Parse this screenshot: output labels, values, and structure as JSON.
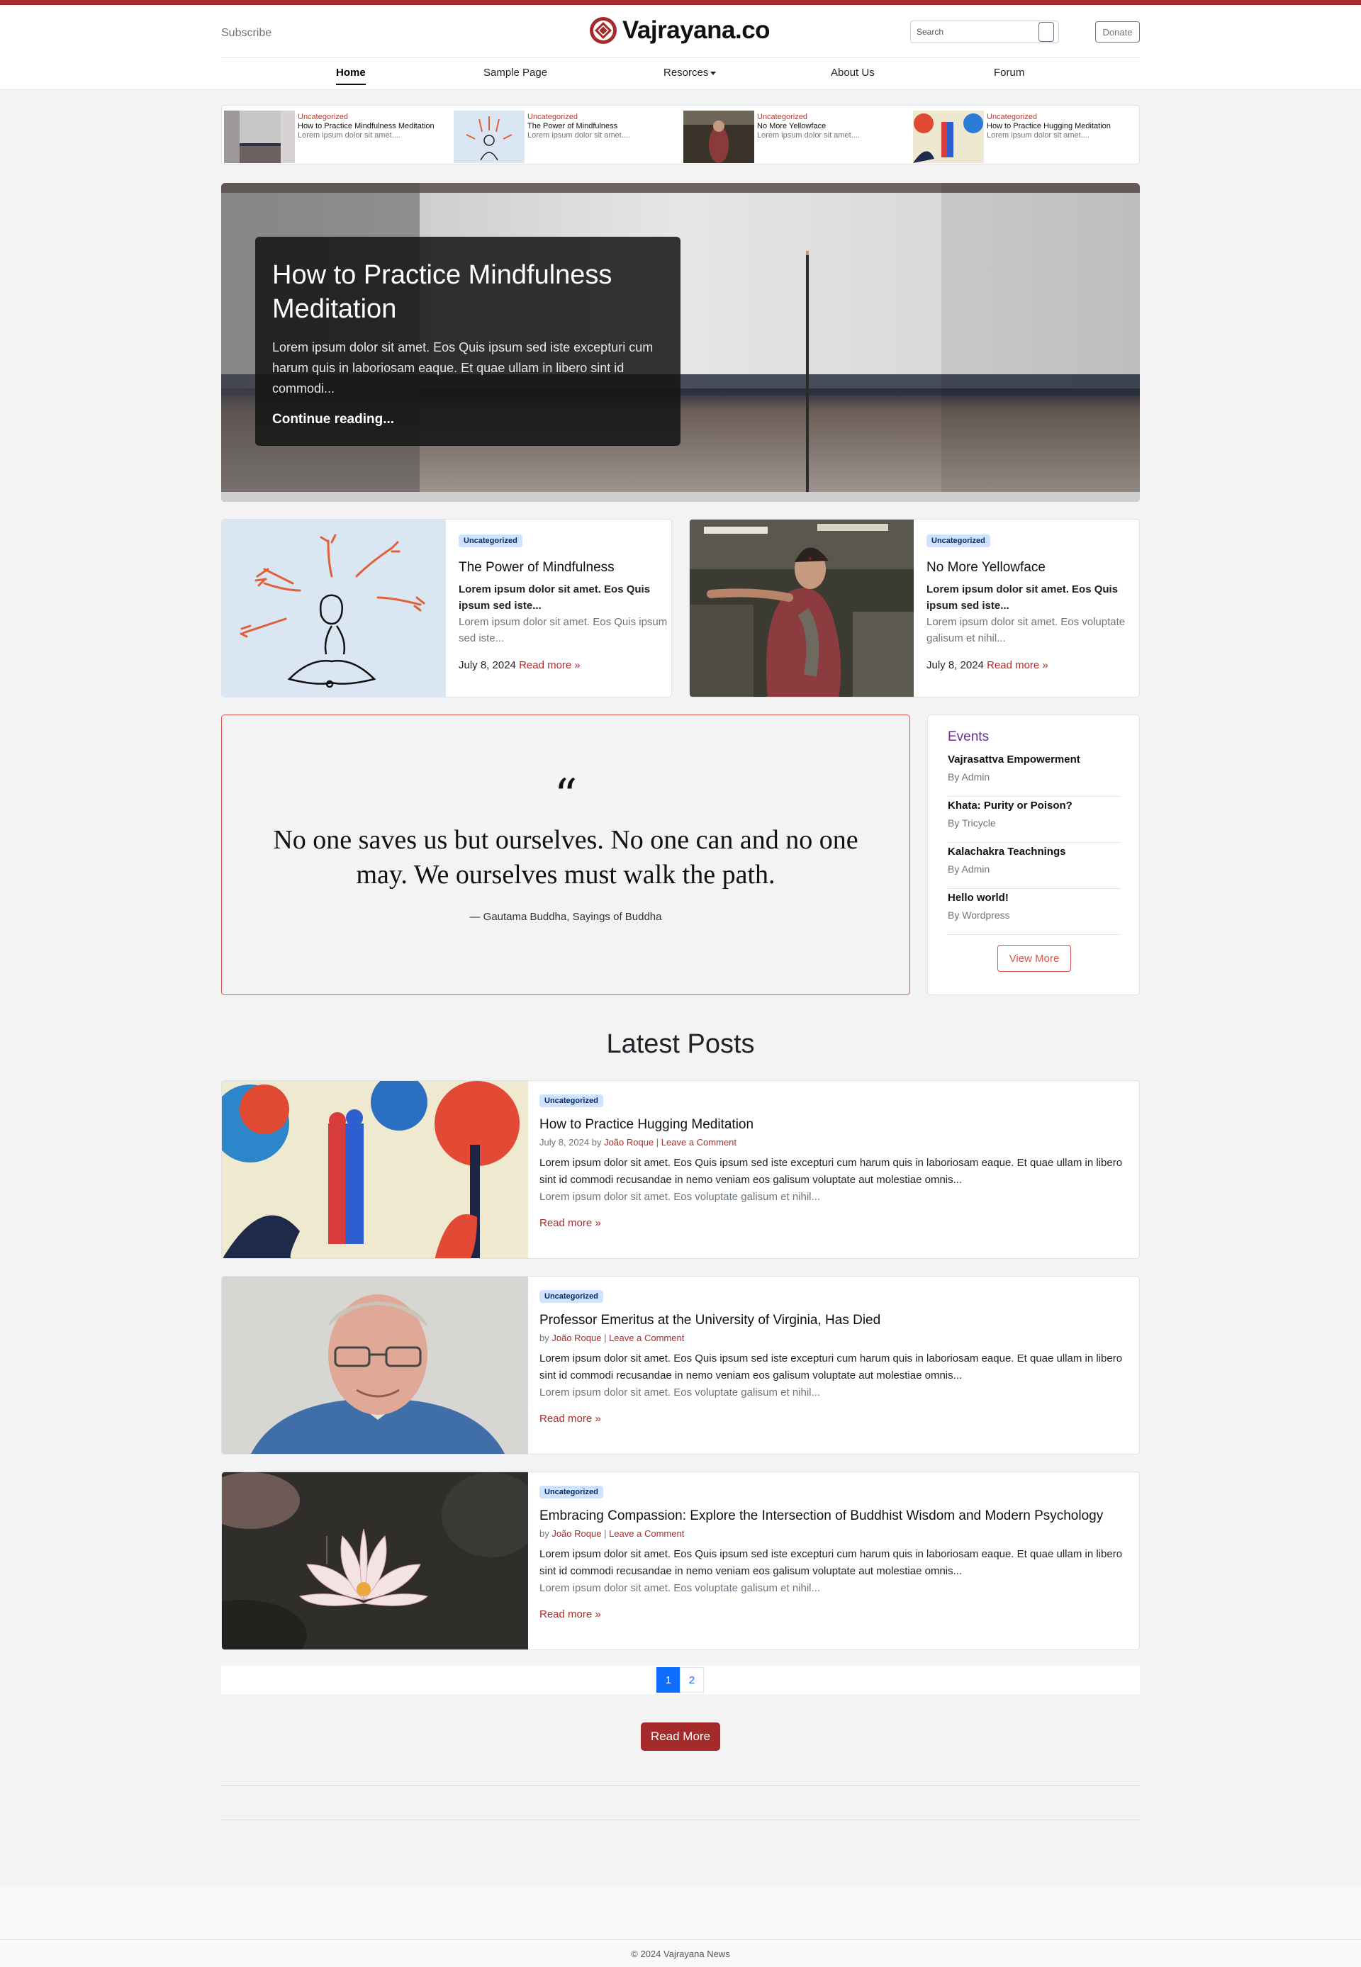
{
  "header": {
    "subscribe": "Subscribe",
    "brand": "Vajrayana.co",
    "search_placeholder": "Search",
    "donate": "Donate",
    "accent_color": "#a52a2a"
  },
  "nav": {
    "items": [
      "Home",
      "Sample Page",
      "Resorces",
      "About Us",
      "Forum"
    ],
    "active": "Home"
  },
  "strip": [
    {
      "category": "Uncategorized",
      "title": "How to Practice Mindfulness Meditation",
      "excerpt": "Lorem ipsum dolor sit amet...."
    },
    {
      "category": "Uncategorized",
      "title": "The Power of Mindfulness",
      "excerpt": "Lorem ipsum dolor sit amet...."
    },
    {
      "category": "Uncategorized",
      "title": "No More Yellowface",
      "excerpt": "Lorem ipsum dolor sit amet...."
    },
    {
      "category": "Uncategorized",
      "title": "How to Practice Hugging Meditation",
      "excerpt": "Lorem ipsum dolor sit amet...."
    }
  ],
  "hero": {
    "title": "How to Practice Mindfulness Meditation",
    "excerpt": "Lorem ipsum dolor sit amet. Eos Quis ipsum sed iste excepturi cum harum quis in laboriosam eaque. Et quae ullam in libero sint id commodi...",
    "more": "Continue reading..."
  },
  "featured": [
    {
      "category": "Uncategorized",
      "title": "The Power of Mindfulness",
      "lead": "Lorem ipsum dolor sit amet. Eos Quis ipsum sed iste...",
      "excerpt": "Lorem ipsum dolor sit amet. Eos Quis ipsum sed iste...",
      "date": "July 8, 2024",
      "more": "Read more »"
    },
    {
      "category": "Uncategorized",
      "title": "No More Yellowface",
      "lead": "Lorem ipsum dolor sit amet. Eos Quis ipsum sed iste...",
      "excerpt": "Lorem ipsum dolor sit amet. Eos voluptate galisum et nihil...",
      "date": "July 8, 2024",
      "more": "Read more »"
    }
  ],
  "quote": {
    "mark": "“",
    "text": "No one saves us but ourselves. No one can and no one may. We ourselves must walk the path.",
    "cite": "— Gautama Buddha, Sayings of Buddha"
  },
  "events": {
    "title": "Events",
    "items": [
      {
        "title": "Vajrasattva Empowerment",
        "by": "By Admin"
      },
      {
        "title": "Khata: Purity or Poison?",
        "by": "By Tricycle"
      },
      {
        "title": "Kalachakra Teachnings",
        "by": "By Admin"
      },
      {
        "title": "Hello world!",
        "by": "By Wordpress"
      }
    ],
    "view_more": "View More"
  },
  "latest": {
    "heading": "Latest Posts",
    "posts": [
      {
        "category": "Uncategorized",
        "title": "How to Practice Hugging Meditation",
        "date": "July 8, 2024 by ",
        "author": "João Roque",
        "comment": "Leave a Comment",
        "excerpt": "Lorem ipsum dolor sit amet. Eos Quis ipsum sed iste excepturi cum harum quis in laboriosam eaque. Et quae ullam in libero sint id commodi recusandae in nemo veniam eos galisum voluptate aut molestiae omnis...",
        "excerpt2": "Lorem ipsum dolor sit amet. Eos voluptate galisum et nihil...",
        "more": "Read more »"
      },
      {
        "category": "Uncategorized",
        "title": "Professor Emeritus at the University of Virginia, Has Died",
        "date": "by ",
        "author": "João Roque",
        "comment": "Leave a Comment",
        "excerpt": "Lorem ipsum dolor sit amet. Eos Quis ipsum sed iste excepturi cum harum quis in laboriosam eaque. Et quae ullam in libero sint id commodi recusandae in nemo veniam eos galisum voluptate aut molestiae omnis...",
        "excerpt2": "Lorem ipsum dolor sit amet. Eos voluptate galisum et nihil...",
        "more": "Read more »"
      },
      {
        "category": "Uncategorized",
        "title": "Embracing Compassion: Explore the Intersection of Buddhist Wisdom and Modern Psychology",
        "date": "by ",
        "author": "João Roque",
        "comment": "Leave a Comment",
        "excerpt": "Lorem ipsum dolor sit amet. Eos Quis ipsum sed iste excepturi cum harum quis in laboriosam eaque. Et quae ullam in libero sint id commodi recusandae in nemo veniam eos galisum voluptate aut molestiae omnis...",
        "excerpt2": "Lorem ipsum dolor sit amet. Eos voluptate galisum et nihil...",
        "more": "Read more »"
      }
    ]
  },
  "pagination": {
    "pages": [
      "1",
      "2"
    ],
    "current": "1"
  },
  "read_more_button": "Read More",
  "footer": {
    "copyright": "© 2024 Vajrayana News"
  }
}
